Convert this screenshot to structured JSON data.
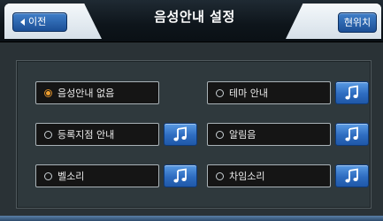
{
  "header": {
    "back_label": "이전",
    "title": "음성안내 설정",
    "location_label": "현위치"
  },
  "options": [
    {
      "label": "음성안내 없음",
      "selected": true,
      "has_sound_button": false
    },
    {
      "label": "테마 안내",
      "selected": false,
      "has_sound_button": true
    },
    {
      "label": "등록지점 안내",
      "selected": false,
      "has_sound_button": true
    },
    {
      "label": "알림음",
      "selected": false,
      "has_sound_button": true
    },
    {
      "label": "벨소리",
      "selected": false,
      "has_sound_button": true
    },
    {
      "label": "차임소리",
      "selected": false,
      "has_sound_button": true
    }
  ],
  "icons": {
    "back": "triangle-left-icon",
    "sound": "music-note-icon"
  },
  "colors": {
    "accent_blue": "#2e6cc0",
    "selected_radio": "#f0a030",
    "background": "#2a3236"
  }
}
